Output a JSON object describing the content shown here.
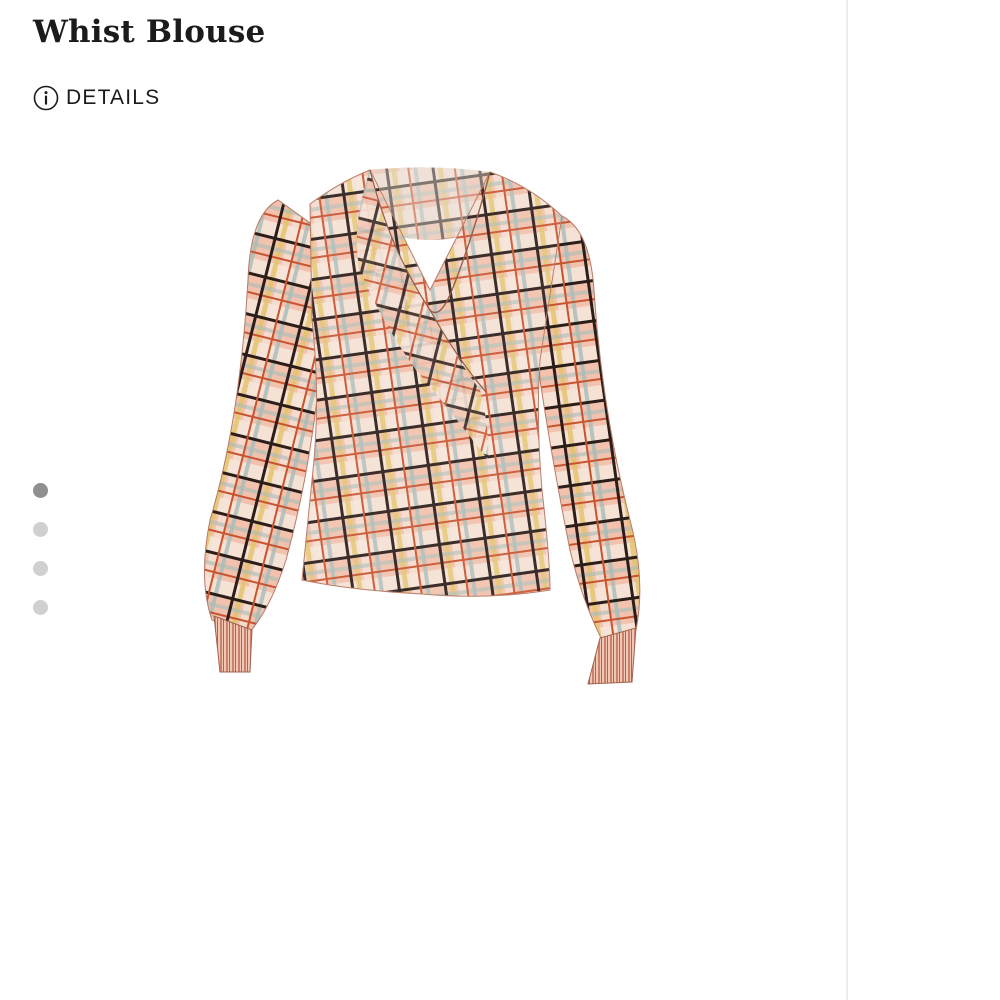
{
  "product": {
    "title": "Whist Blouse",
    "image_subject": "blouse-image"
  },
  "details": {
    "label": "DETAILS",
    "icon": "info-icon"
  },
  "gallery": {
    "dots": [
      {
        "active": true
      },
      {
        "active": false
      },
      {
        "active": false
      },
      {
        "active": false
      }
    ]
  },
  "colors": {
    "text": "#1b1b1b",
    "dot_active": "#8f8f8f",
    "dot_inactive": "#d0d0d0",
    "divider": "#ececec",
    "fabric_base": "#f1c4b2",
    "fabric_light": "#f6e7de",
    "plaid_dark": "#2b1d18",
    "plaid_rust": "#c8532f",
    "plaid_yellow": "#e2c36a",
    "plaid_teal": "#9fb7b4"
  }
}
